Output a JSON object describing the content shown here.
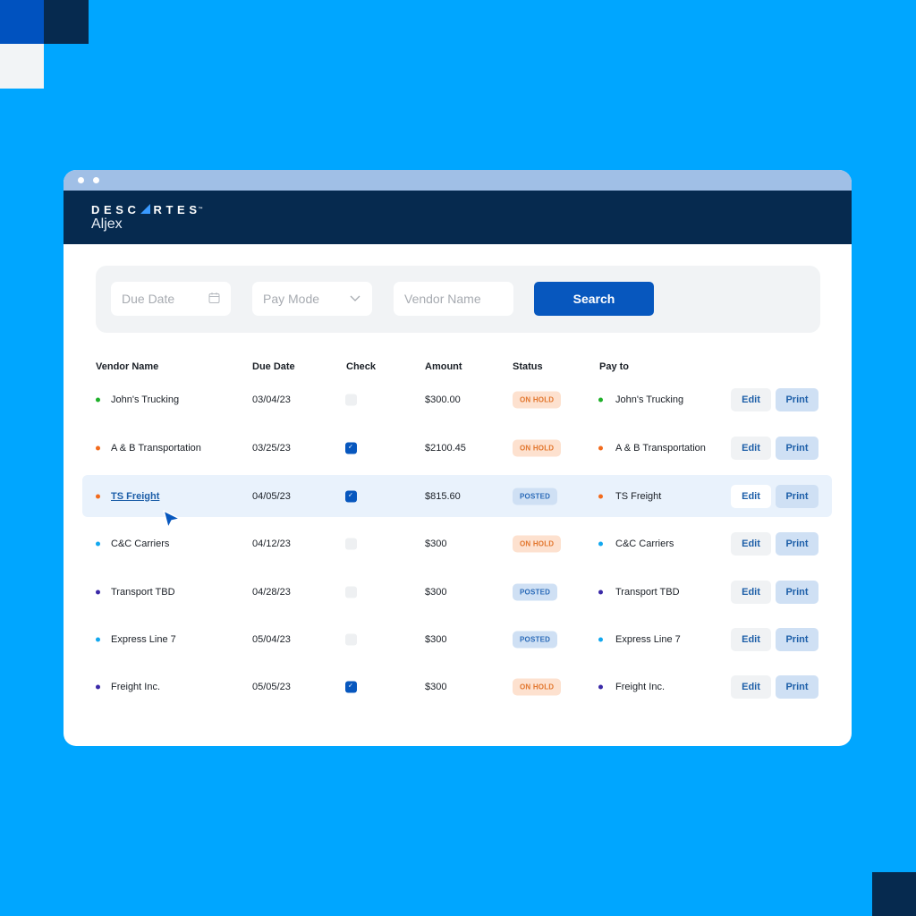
{
  "app": {
    "brand": "DESCARTES",
    "brand_tm": "™",
    "product": "Aljex"
  },
  "filters": {
    "due_date_placeholder": "Due Date",
    "pay_mode_placeholder": "Pay Mode",
    "vendor_name_placeholder": "Vendor Name",
    "search_label": "Search",
    "icons": {
      "due_date": "calendar-icon",
      "pay_mode": "chevron-down-icon"
    }
  },
  "table": {
    "columns": {
      "vendor": "Vendor Name",
      "due_date": "Due Date",
      "check": "Check",
      "amount": "Amount",
      "status": "Status",
      "pay_to": "Pay to"
    },
    "edit_label": "Edit",
    "print_label": "Print",
    "rows": [
      {
        "vendor": "John's Trucking",
        "dot_color": "#1fb02a",
        "due_date": "03/04/23",
        "checked": false,
        "amount": "$300.00",
        "status": "ON HOLD",
        "pay_to": "John's Trucking"
      },
      {
        "vendor": "A & B Transportation",
        "dot_color": "#f26b1d",
        "due_date": "03/25/23",
        "checked": true,
        "amount": "$2100.45",
        "status": "ON HOLD",
        "pay_to": "A & B Transportation"
      },
      {
        "vendor": "TS Freight",
        "dot_color": "#f26b1d",
        "due_date": "04/05/23",
        "checked": true,
        "amount": "$815.60",
        "status": "POSTED",
        "pay_to": "TS Freight",
        "highlighted": true,
        "link": true
      },
      {
        "vendor": "C&C Carriers",
        "dot_color": "#12a8ef",
        "due_date": "04/12/23",
        "checked": false,
        "amount": "$300",
        "status": "ON HOLD",
        "pay_to": "C&C Carriers"
      },
      {
        "vendor": "Transport TBD",
        "dot_color": "#3b2aa8",
        "due_date": "04/28/23",
        "checked": false,
        "amount": "$300",
        "status": "POSTED",
        "pay_to": "Transport TBD"
      },
      {
        "vendor": "Express Line 7",
        "dot_color": "#12a8ef",
        "due_date": "05/04/23",
        "checked": false,
        "amount": "$300",
        "status": "POSTED",
        "pay_to": "Express Line 7"
      },
      {
        "vendor": "Freight Inc.",
        "dot_color": "#3b2aa8",
        "due_date": "05/05/23",
        "checked": true,
        "amount": "$300",
        "status": "ON HOLD",
        "pay_to": "Freight Inc."
      }
    ]
  },
  "colors": {
    "background": "#00a6ff",
    "header": "#062a4f",
    "primary": "#0757be",
    "on_hold_bg": "#fde1cf",
    "on_hold_text": "#e2762d",
    "posted_bg": "#cfe0f4",
    "posted_text": "#2a6ab8"
  }
}
